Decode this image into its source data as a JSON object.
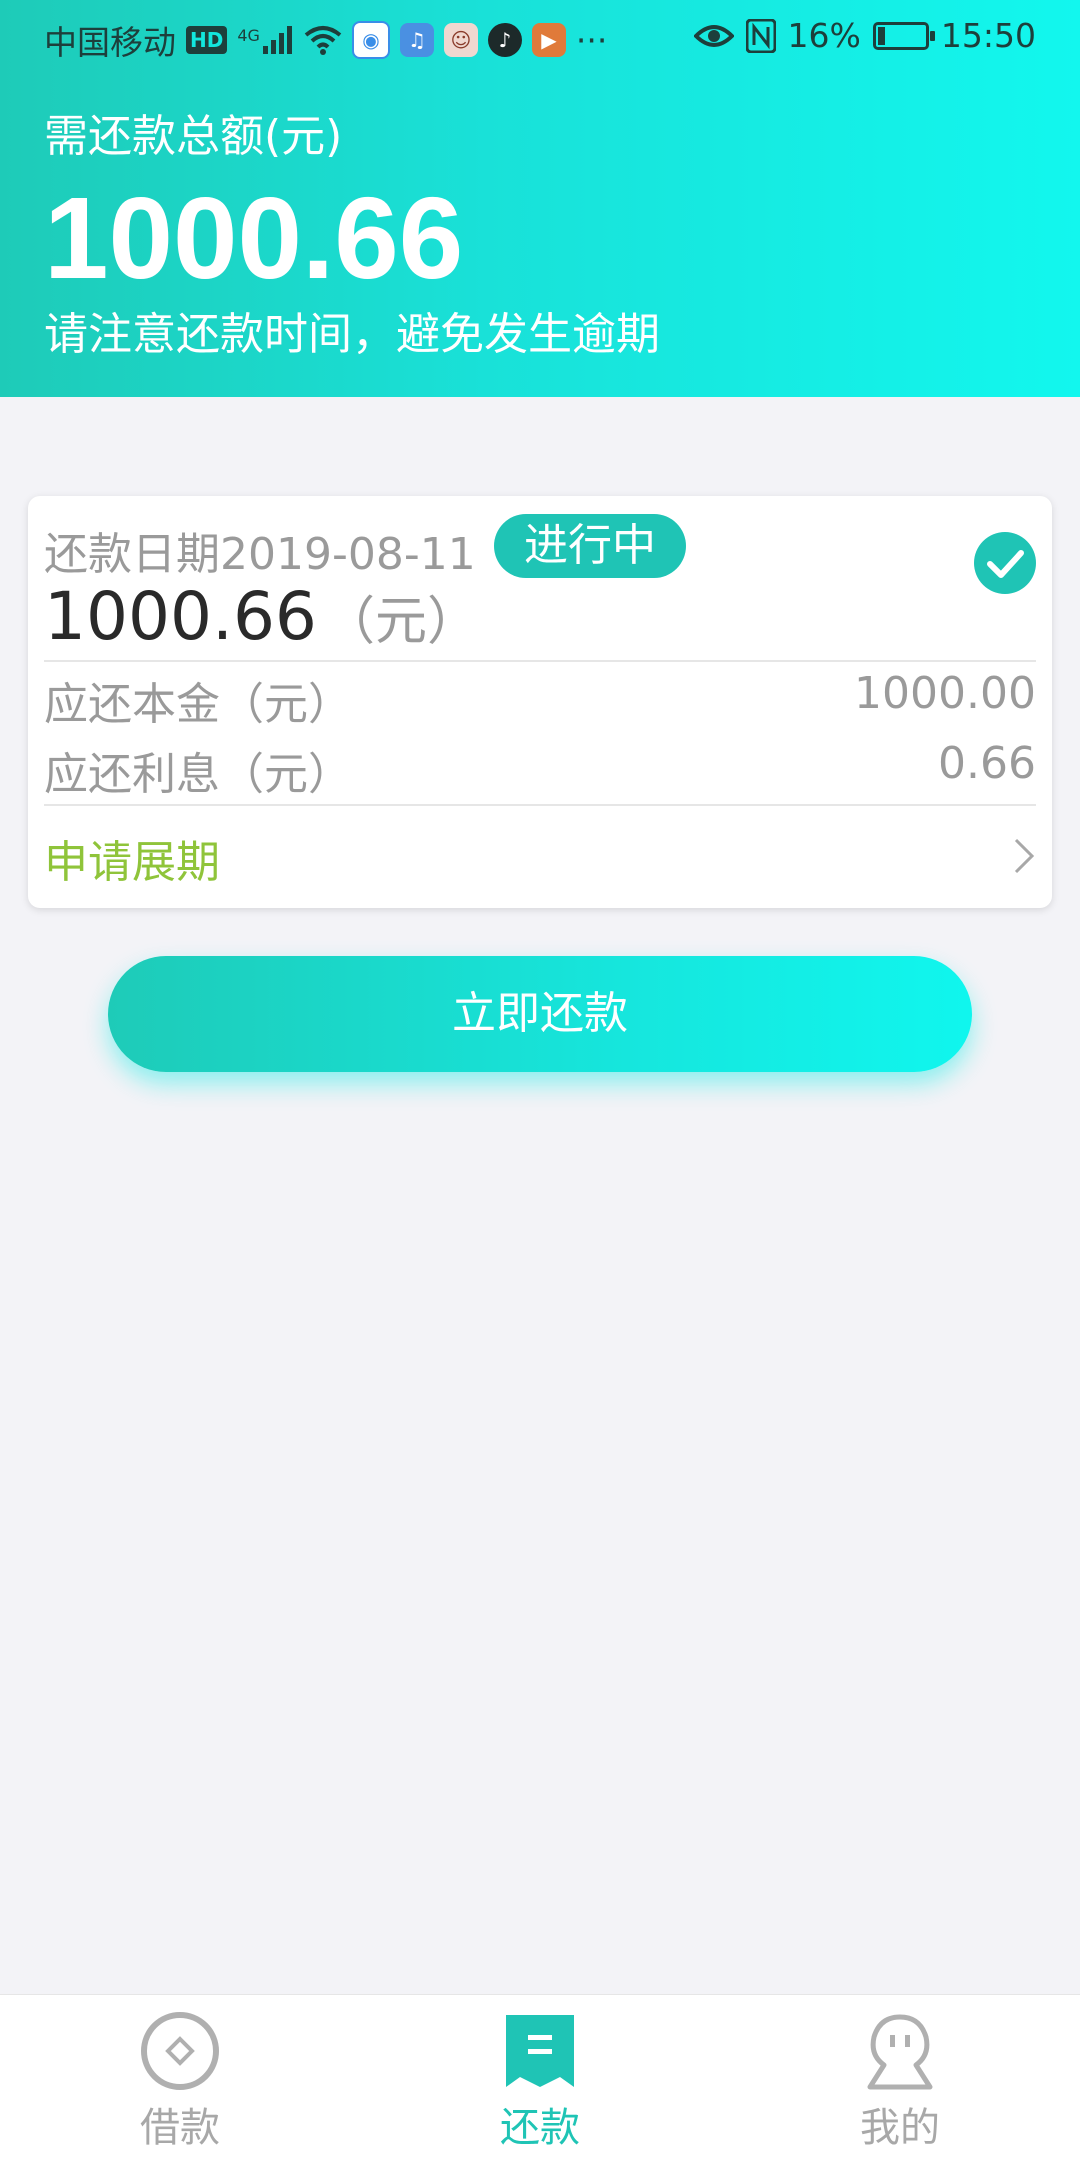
{
  "status_bar": {
    "carrier": "中国移动",
    "hd_badge": "HD",
    "network": "4G",
    "more": "···",
    "battery_percent": "16%",
    "battery_level": 0.16,
    "time": "15:50"
  },
  "header": {
    "label": "需还款总额(元)",
    "amount": "1000.66",
    "notice": "请注意还款时间，避免发生逾期"
  },
  "card": {
    "date_label": "还款日期2019-08-11",
    "status": "进行中",
    "amount": "1000.66",
    "amount_unit": "（元）",
    "principal_label": "应还本金（元）",
    "principal_value": "1000.00",
    "interest_label": "应还利息（元）",
    "interest_value": "0.66",
    "extend_label": "申请展期"
  },
  "pay_button": {
    "label": "立即还款"
  },
  "bottom_nav": {
    "items": [
      {
        "label": "借款",
        "icon": "loan-icon",
        "active": false
      },
      {
        "label": "还款",
        "icon": "repay-icon",
        "active": true
      },
      {
        "label": "我的",
        "icon": "profile-icon",
        "active": false
      }
    ]
  },
  "colors": {
    "accent": "#1fc4b5",
    "extend": "#8fc43a",
    "inactive": "#b0b0b0"
  }
}
